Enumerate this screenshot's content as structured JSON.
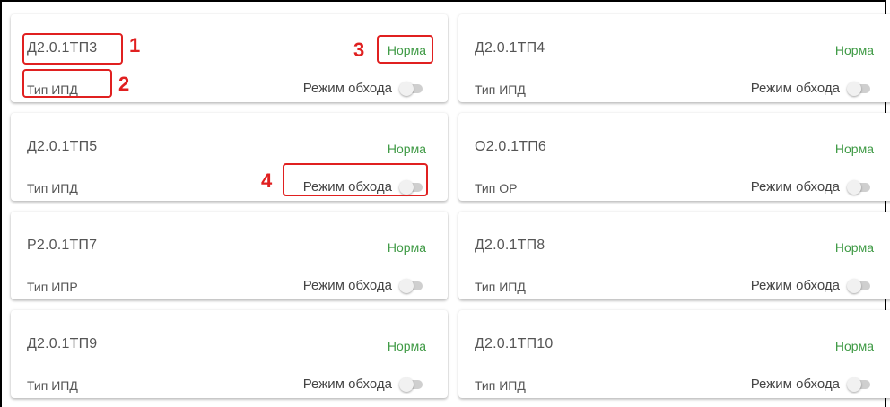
{
  "cards": [
    {
      "name": "Д2.0.1ТП3",
      "type": "Тип ИПД",
      "status": "Норма",
      "bypass": "Режим обхода"
    },
    {
      "name": "Д2.0.1ТП4",
      "type": "Тип ИПД",
      "status": "Норма",
      "bypass": "Режим обхода"
    },
    {
      "name": "Д2.0.1ТП5",
      "type": "Тип ИПД",
      "status": "Норма",
      "bypass": "Режим обхода"
    },
    {
      "name": "О2.0.1ТП6",
      "type": "Тип ОР",
      "status": "Норма",
      "bypass": "Режим обхода"
    },
    {
      "name": "Р2.0.1ТП7",
      "type": "Тип ИПР",
      "status": "Норма",
      "bypass": "Режим обхода"
    },
    {
      "name": "Д2.0.1ТП8",
      "type": "Тип ИПД",
      "status": "Норма",
      "bypass": "Режим обхода"
    },
    {
      "name": "Д2.0.1ТП9",
      "type": "Тип ИПД",
      "status": "Норма",
      "bypass": "Режим обхода"
    },
    {
      "name": "Д2.0.1ТП10",
      "type": "Тип ИПД",
      "status": "Норма",
      "bypass": "Режим обхода"
    }
  ],
  "annotations": {
    "n1": "1",
    "n2": "2",
    "n3": "3",
    "n4": "4"
  },
  "colors": {
    "status_ok": "#3f9a45",
    "annotation": "#e02020"
  },
  "toggle_state": "off"
}
